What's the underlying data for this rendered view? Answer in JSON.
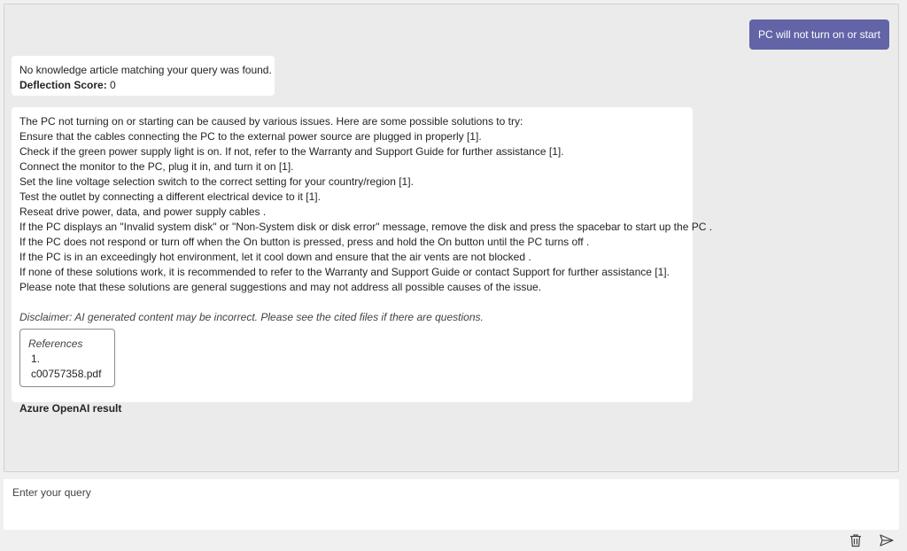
{
  "conversation": {
    "user_query": "PC will not turn on or start",
    "kb_response": {
      "message": "No knowledge article matching your query was found.",
      "deflection_label": "Deflection Score:",
      "deflection_value": "0"
    },
    "ai_response": {
      "lines": [
        "The PC not turning on or starting can be caused by various issues. Here are some possible solutions to try:",
        "Ensure that the cables connecting the PC to the external power source are plugged in properly [1].",
        "Check if the green power supply light is on. If not, refer to the Warranty and Support Guide for further assistance [1].",
        "Connect the monitor to the PC, plug it in, and turn it on [1].",
        "Set the line voltage selection switch to the correct setting for your country/region [1].",
        "Test the outlet by connecting a different electrical device to it [1].",
        "Reseat drive power, data, and power supply cables .",
        "If the PC displays an \"Invalid system disk\" or \"Non-System disk or disk error\" message, remove the disk and press the spacebar to start up the PC .",
        "If the PC does not respond or turn off when the On button is pressed, press and hold the On button until the PC turns off .",
        "If the PC is in an exceedingly hot environment, let it cool down and ensure that the air vents are not blocked .",
        "If none of these solutions work, it is recommended to refer to the Warranty and Support Guide or contact Support for further assistance [1].",
        "Please note that these solutions are general suggestions and may not address all possible causes of the issue."
      ],
      "disclaimer": "Disclaimer: AI generated content may be incorrect. Please see the cited files if there are questions.",
      "references_title": "References",
      "references": [
        "1. c00757358.pdf"
      ],
      "result_label": "Azure OpenAI result"
    }
  },
  "input": {
    "placeholder": "Enter your query",
    "value": ""
  },
  "toolbar": {
    "clear_icon": "trash-icon",
    "send_icon": "send-icon"
  },
  "colors": {
    "accent": "#6264a7"
  }
}
